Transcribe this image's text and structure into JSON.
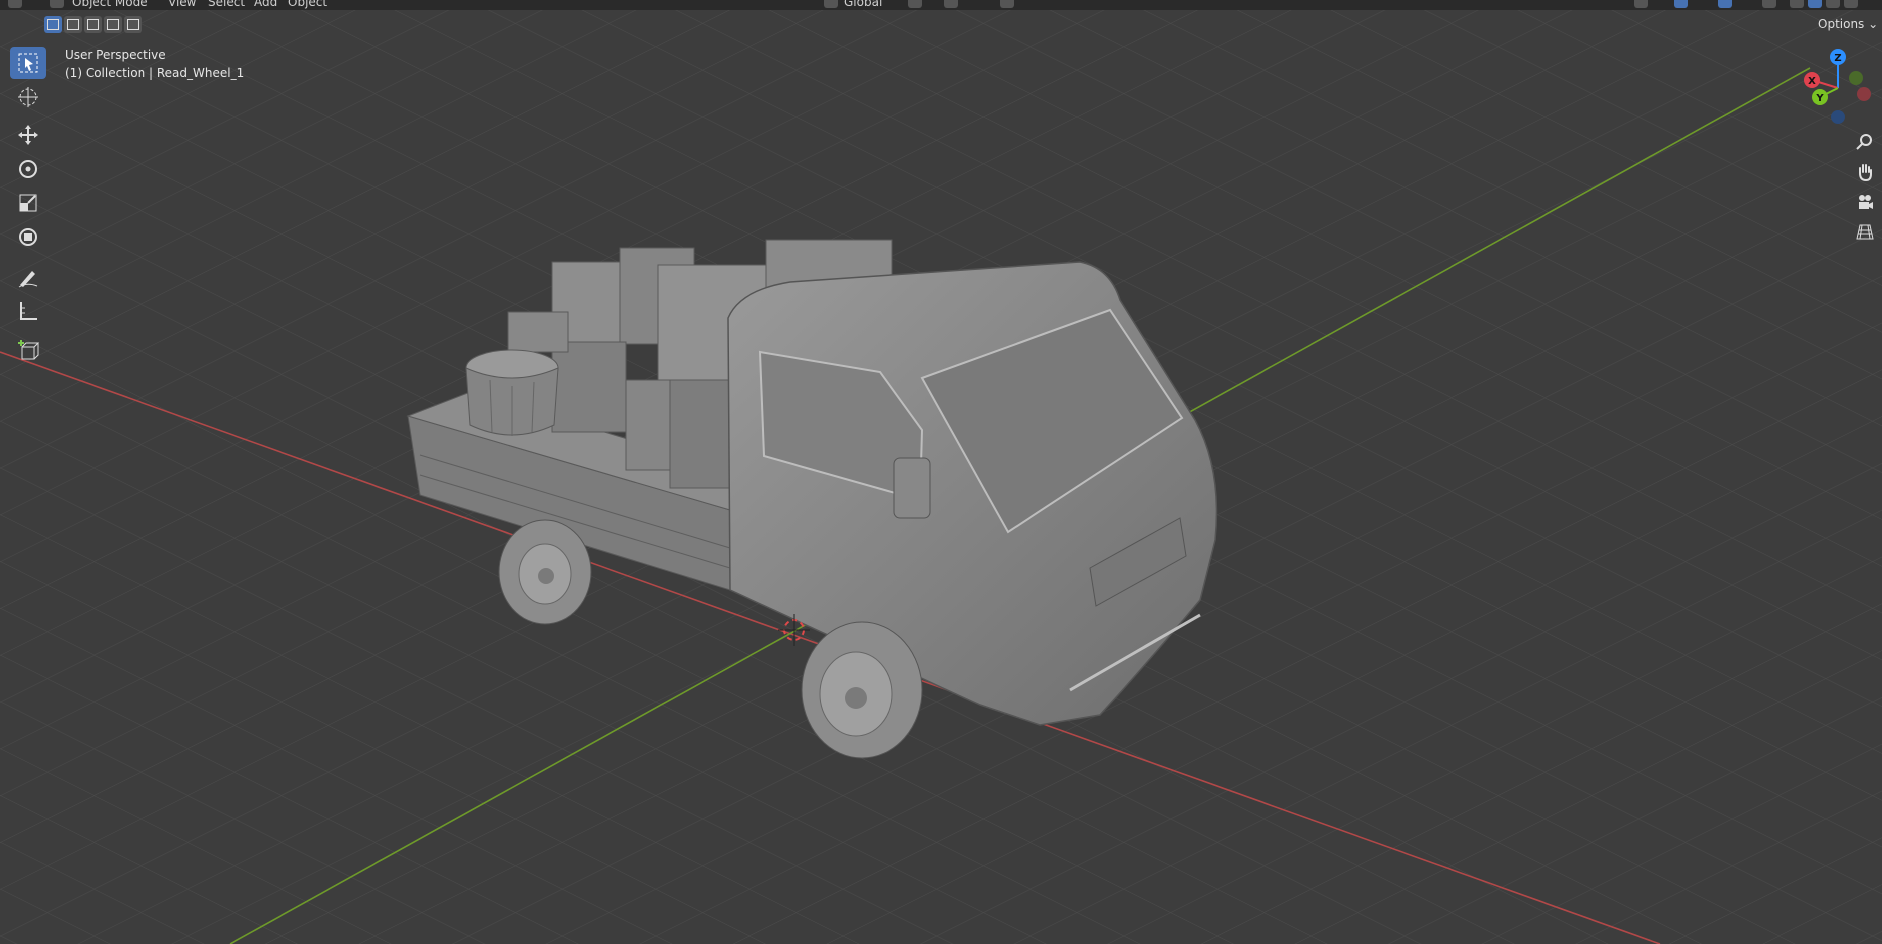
{
  "header": {
    "mode_label": "Object Mode",
    "menus": [
      "View",
      "Select",
      "Add",
      "Object"
    ],
    "transform_orientation": "Global",
    "options_label": "Options"
  },
  "select_modes": [
    "new",
    "extend",
    "subtract",
    "difference",
    "intersect"
  ],
  "viewport": {
    "perspective_label": "User Perspective",
    "collection_label": "(1) Collection | Read_Wheel_1",
    "background_color": "#3d3d3d",
    "grid_color": "#4a4a4a",
    "x_axis_color": "#b24848",
    "y_axis_color": "#6e9a2a"
  },
  "toolbar": {
    "tools": [
      {
        "name": "select-box-icon",
        "active": true
      },
      {
        "name": "cursor-icon",
        "active": false
      },
      {
        "name": "move-icon",
        "active": false
      },
      {
        "name": "rotate-icon",
        "active": false
      },
      {
        "name": "scale-icon",
        "active": false
      },
      {
        "name": "transform-icon",
        "active": false
      },
      {
        "name": "annotate-icon",
        "active": false
      },
      {
        "name": "measure-icon",
        "active": false
      },
      {
        "name": "add-cube-icon",
        "active": false
      }
    ]
  },
  "gizmo": {
    "axes": [
      {
        "label": "X",
        "color": "#e0424e"
      },
      {
        "label": "Y",
        "color": "#79c323"
      },
      {
        "label": "Z",
        "color": "#2c8fff"
      }
    ]
  },
  "nav_icons": [
    "zoom-icon",
    "pan-hand-icon",
    "camera-icon",
    "grid-view-icon"
  ],
  "accent_color": "#4772b3"
}
